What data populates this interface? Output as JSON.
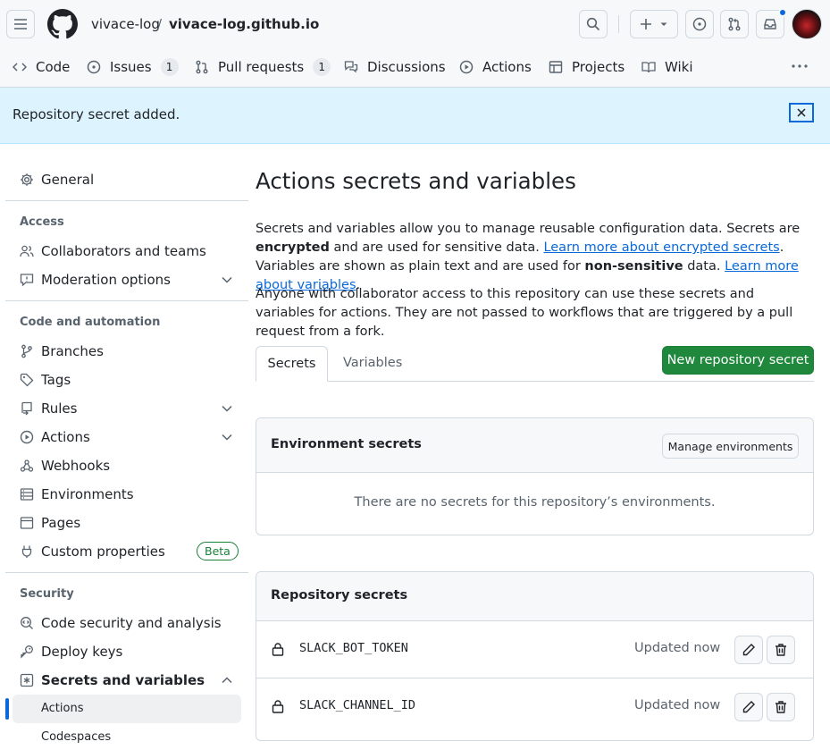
{
  "header": {
    "owner": "vivace-log",
    "separator": "/",
    "repo": "vivace-log.github.io"
  },
  "nav": {
    "code": "Code",
    "issues": "Issues",
    "issues_count": "1",
    "pulls": "Pull requests",
    "pulls_count": "1",
    "discussions": "Discussions",
    "actions": "Actions",
    "projects": "Projects",
    "wiki": "Wiki"
  },
  "flash": {
    "message": "Repository secret added."
  },
  "sidebar": {
    "general": "General",
    "access_heading": "Access",
    "collaborators": "Collaborators and teams",
    "moderation": "Moderation options",
    "code_heading": "Code and automation",
    "branches": "Branches",
    "tags": "Tags",
    "rules": "Rules",
    "actions": "Actions",
    "webhooks": "Webhooks",
    "environments": "Environments",
    "pages": "Pages",
    "custom_properties": "Custom properties",
    "beta": "Beta",
    "security_heading": "Security",
    "code_security": "Code security and analysis",
    "deploy_keys": "Deploy keys",
    "secrets_vars": "Secrets and variables",
    "sub_actions": "Actions",
    "sub_codespaces": "Codespaces"
  },
  "main": {
    "title": "Actions secrets and variables",
    "p1_a": "Secrets and variables allow you to manage reusable configuration data. Secrets are ",
    "p1_b": "encrypted",
    "p1_c": " and are used for sensitive data. ",
    "p1_link1": "Learn more about encrypted secrets",
    "p1_d": ". Variables are shown as plain text and are used for ",
    "p1_e": "non-sensitive",
    "p1_f": " data. ",
    "p1_link2": "Learn more about variables",
    "p1_g": ".",
    "p2": "Anyone with collaborator access to this repository can use these secrets and variables for actions. They are not passed to workflows that are triggered by a pull request from a fork.",
    "tab_secrets": "Secrets",
    "tab_variables": "Variables",
    "new_secret_button": "New repository secret",
    "env_title": "Environment secrets",
    "manage_env_button": "Manage environments",
    "env_empty": "There are no secrets for this repository’s environments.",
    "repo_title": "Repository secrets",
    "secrets": [
      {
        "name": "SLACK_BOT_TOKEN",
        "updated": "Updated now"
      },
      {
        "name": "SLACK_CHANNEL_ID",
        "updated": "Updated now"
      }
    ]
  },
  "colors": {
    "accent": "#0969da",
    "primary_button": "#1f883d",
    "flash_bg": "#ddf4ff",
    "active_indicator": "#0969da"
  }
}
